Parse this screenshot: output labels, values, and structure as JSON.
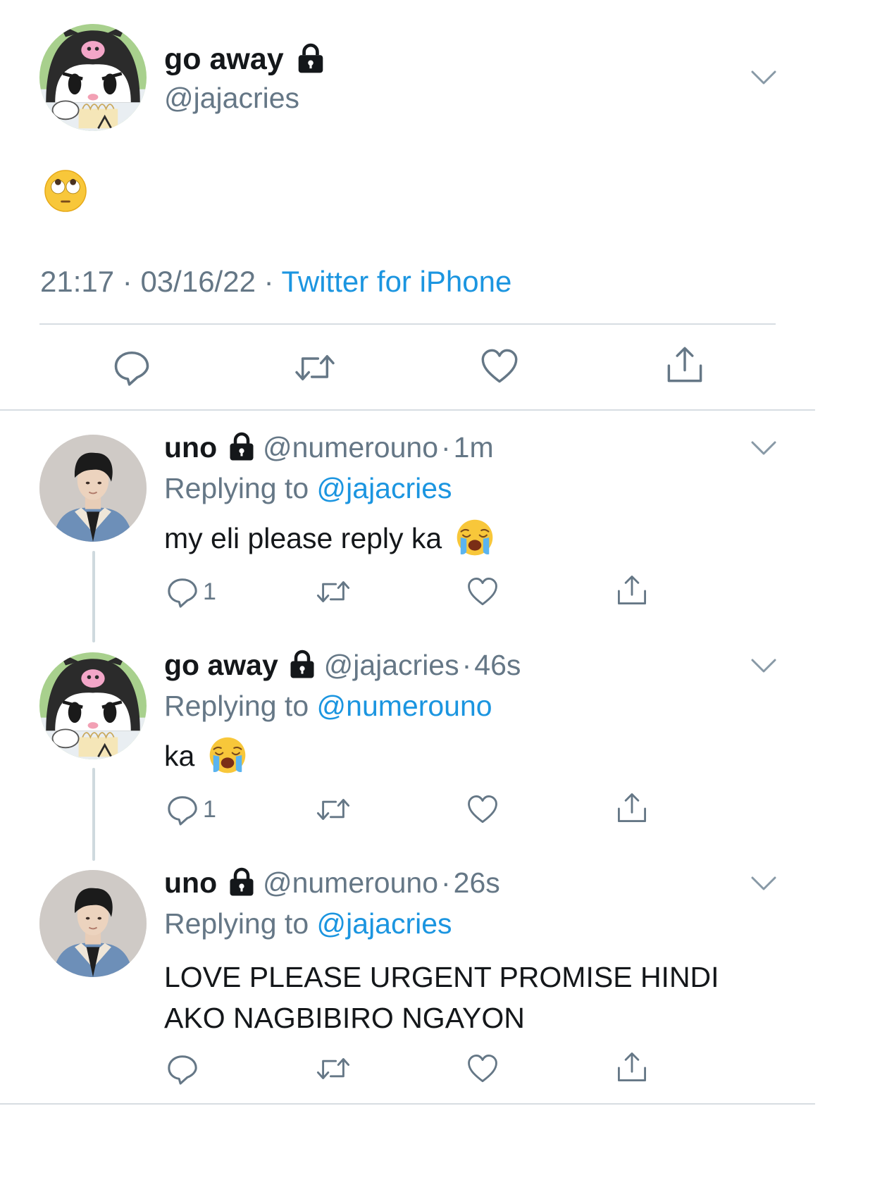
{
  "main_tweet": {
    "display_name": "go away",
    "handle": "@jajacries",
    "body_emoji": "face-with-rolling-eyes",
    "time": "21:17",
    "date": "03/16/22",
    "separator": "·",
    "source": "Twitter for iPhone"
  },
  "replies": [
    {
      "display_name": "uno",
      "handle": "@numerouno",
      "age": "1m",
      "replying_prefix": "Replying to",
      "replying_to": "@jajacries",
      "text": "my eli please reply ka",
      "reply_count": "1"
    },
    {
      "display_name": "go away",
      "handle": "@jajacries",
      "age": "46s",
      "replying_prefix": "Replying to",
      "replying_to": "@numerouno",
      "text": "ka",
      "reply_count": "1"
    },
    {
      "display_name": "uno",
      "handle": "@numerouno",
      "age": "26s",
      "replying_prefix": "Replying to",
      "replying_to": "@jajacries",
      "text_line1": "LOVE PLEASE URGENT PROMISE HINDI",
      "text_line2": "AKO NAGBIBIRO NGAYON"
    }
  ],
  "dot": "·",
  "colors": {
    "blue": "#1b95e0",
    "gray": "#657786",
    "text": "#14171a",
    "icon": "#657786"
  }
}
